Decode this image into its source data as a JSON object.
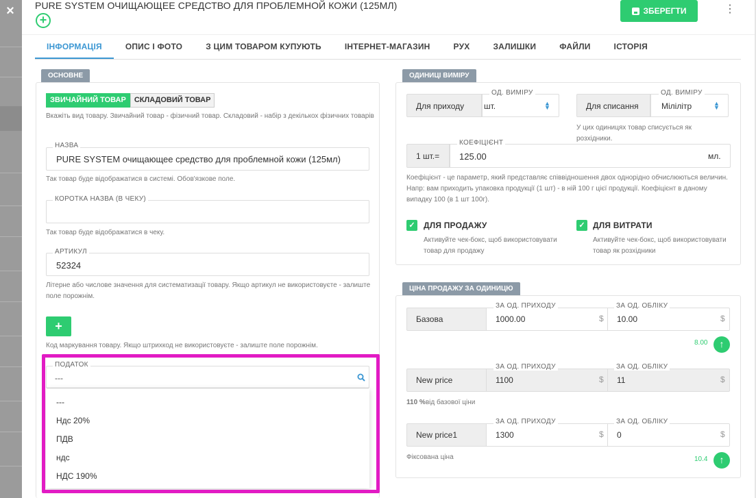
{
  "window": {
    "close_label": "×"
  },
  "header": {
    "title": "PURE SYSTEM ОЧИЩАЮЩЕЕ СРЕДСТВО ДЛЯ ПРОБЛЕМНОЙ КОЖИ (125МЛ)",
    "add_label": "+",
    "save_label": "ЗБЕРЕГТИ",
    "menu_label": "⋮"
  },
  "tabs": [
    {
      "label": "ІНФОРМАЦІЯ",
      "active": true
    },
    {
      "label": "ОПИС І ФОТО"
    },
    {
      "label": "З ЦИМ ТОВАРОМ КУПУЮТЬ"
    },
    {
      "label": "ІНТЕРНЕТ-МАГАЗИН"
    },
    {
      "label": "РУХ"
    },
    {
      "label": "ЗАЛИШКИ"
    },
    {
      "label": "ФАЙЛИ"
    },
    {
      "label": "ІСТОРІЯ"
    }
  ],
  "basic": {
    "section_label": "ОСНОВНЕ",
    "toggle_simple": "ЗВИЧАЙНИЙ ТОВАР",
    "toggle_composite": "СКЛАДОВИЙ ТОВАР",
    "type_help": "Вкажіть вид товару. Звичайний товар - фізичний товар. Складовий - набір з декількох фізичних товарів",
    "name_label": "НАЗВА",
    "name_value": "PURE SYSTEM очищающее средство для проблемной кожи (125мл)",
    "name_help": "Так товар буде відображатися в системі. Обов'язкове поле.",
    "short_label": "КОРОТКА НАЗВА (В ЧЕКУ)",
    "short_value": "",
    "short_help": "Так товар буде відображатися в чеку.",
    "article_label": "АРТИКУЛ",
    "article_value": "52324",
    "article_help": "Літерне або числове значення для систематизації товару. Якщо артикул не використовуєте - залиште поле порожнім.",
    "barcode_add": "+",
    "barcode_help": "Код маркування товару. Якщо штрихкод не використовуєте - залиште поле порожнім.",
    "tax_label": "ПОДАТОК",
    "tax_value": "---",
    "tax_options": [
      "---",
      "Ндс 20%",
      "ПДВ",
      "ндс",
      "НДС 190%"
    ]
  },
  "units": {
    "section_label": "ОДИНИЦІ ВИМІРУ",
    "incoming_label": "Для приходу",
    "incoming_unit_label": "ОД. ВИМІРУ",
    "incoming_unit": "шт.",
    "writeoff_label": "Для списання",
    "writeoff_unit_label": "ОД. ВИМІРУ",
    "writeoff_unit": "Мililitр",
    "writeoff_help": "У цих одиницях товар списується як розхідники.",
    "coef_prefix": "1 шт.=",
    "coef_label": "КОЕФІЦІЄНТ",
    "coef_value": "125.00",
    "coef_suffix": "мл.",
    "coef_help": "Коефіцієнт - це параметр, який представляє співвідношення двох однорідно обчислюються величин. Напр: вам приходить упаковка продукції (1 шт) - в ній 100 г цієї продукції. Коефіцієнт в даному випадку 100 (в 1 шт 100г).",
    "for_sale_label": "ДЛЯ ПРОДАЖУ",
    "for_sale_help": "Активуйте чек-бокс, щоб використовувати товар для продажу",
    "for_expense_label": "ДЛЯ ВИТРАТИ",
    "for_expense_help": "Активуйте чек-бокс, щоб використовувати товар як розхідники",
    "check_mark": "✓"
  },
  "prices": {
    "section_label": "ЦІНА ПРОДАЖУ ЗА ОДИНИЦЮ",
    "col_incoming": "ЗА ОД. ПРИХОДУ",
    "col_accounting": "ЗА ОД. ОБЛІКУ",
    "currency": "$",
    "arrow": "↑",
    "rows": [
      {
        "name": "Базова",
        "incoming": "1000.00",
        "accounting": "10.00",
        "note": "",
        "side": "8.00"
      },
      {
        "name": "New price",
        "incoming": "1100",
        "accounting": "11",
        "note_bold": "110 %",
        "note": "від базової ціни",
        "side": ""
      },
      {
        "name": "New price1",
        "incoming": "1300",
        "accounting": "0",
        "note": "Фіксована ціна",
        "side": "10.4"
      }
    ]
  },
  "colors": {
    "accent": "#2ecc71",
    "tab_active": "#3c97d3",
    "highlight": "#e21bc4",
    "section": "#8c9aa7"
  }
}
